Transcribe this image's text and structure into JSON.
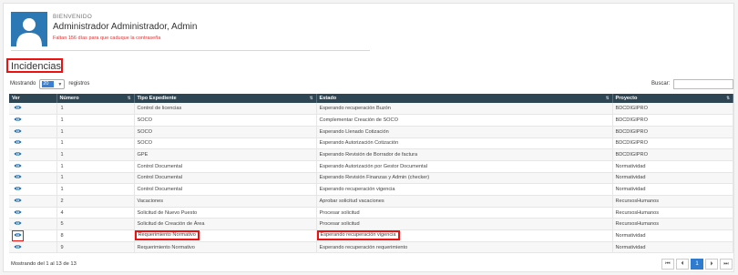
{
  "welcome": {
    "greeting": "BIENVENIDO",
    "user_name": "Administrador Administrador, Admin",
    "password_warning": "Faltan 156 días para que caduque la contraseña"
  },
  "page_title": "Incidencias",
  "length": {
    "prefix": "Mostrando",
    "value": "20",
    "suffix": "registros"
  },
  "search": {
    "label": "Buscar:",
    "value": ""
  },
  "table": {
    "headers": [
      "Ver",
      "Número",
      "Tipo Expediente",
      "Estado",
      "Proyecto"
    ],
    "rows": [
      {
        "numero": "1",
        "tipo": "Control de licencias",
        "estado": "Esperando recuperación Buzón",
        "proyecto": "BDCDIGIPRO"
      },
      {
        "numero": "1",
        "tipo": "SOCO",
        "estado": "Complementar Creación de SOCO",
        "proyecto": "BDCDIGIPRO"
      },
      {
        "numero": "1",
        "tipo": "SOCO",
        "estado": "Esperando Llenado Cotización",
        "proyecto": "BDCDIGIPRO"
      },
      {
        "numero": "1",
        "tipo": "SOCO",
        "estado": "Esperando Autorización Cotización",
        "proyecto": "BDCDIGIPRO"
      },
      {
        "numero": "1",
        "tipo": "GPE",
        "estado": "Esperando Revisión de Borrador de factura",
        "proyecto": "BDCDIGIPRO"
      },
      {
        "numero": "1",
        "tipo": "Control Documental",
        "estado": "Esperando Autorización por Gestor Documental",
        "proyecto": "Normatividad"
      },
      {
        "numero": "1",
        "tipo": "Control Documental",
        "estado": "Esperando Revisión Finanzas y Admin (checker)",
        "proyecto": "Normatividad"
      },
      {
        "numero": "1",
        "tipo": "Control Documental",
        "estado": "Esperando recuperación vigencia",
        "proyecto": "Normatividad"
      },
      {
        "numero": "2",
        "tipo": "Vacaciones",
        "estado": "Aprobar solicitud vacaciones",
        "proyecto": "RecursosHumanos"
      },
      {
        "numero": "4",
        "tipo": "Solicitud de Nuevo Puesto",
        "estado": "Procesar solicitud",
        "proyecto": "RecursosHumanos"
      },
      {
        "numero": "5",
        "tipo": "Solicitud de Creación de Área",
        "estado": "Procesar solicitud",
        "proyecto": "RecursosHumanos"
      },
      {
        "numero": "8",
        "tipo": "Requerimiento Normativo",
        "estado": "Esperando recuperación vigencia",
        "proyecto": "Normatividad"
      },
      {
        "numero": "9",
        "tipo": "Requerimiento Normativo",
        "estado": "Esperando recuperación requerimiento",
        "proyecto": "Normatividad"
      }
    ]
  },
  "info": "Mostrando del 1 al 13 de 13",
  "pagination": {
    "first": "⏮",
    "prev": "⏴",
    "current": "1",
    "next": "⏵",
    "last": "⏭"
  },
  "colors": {
    "header_bg": "#2e4553",
    "accent": "#2b78b4",
    "highlight": "#e11111",
    "warning": "#dd3333"
  }
}
